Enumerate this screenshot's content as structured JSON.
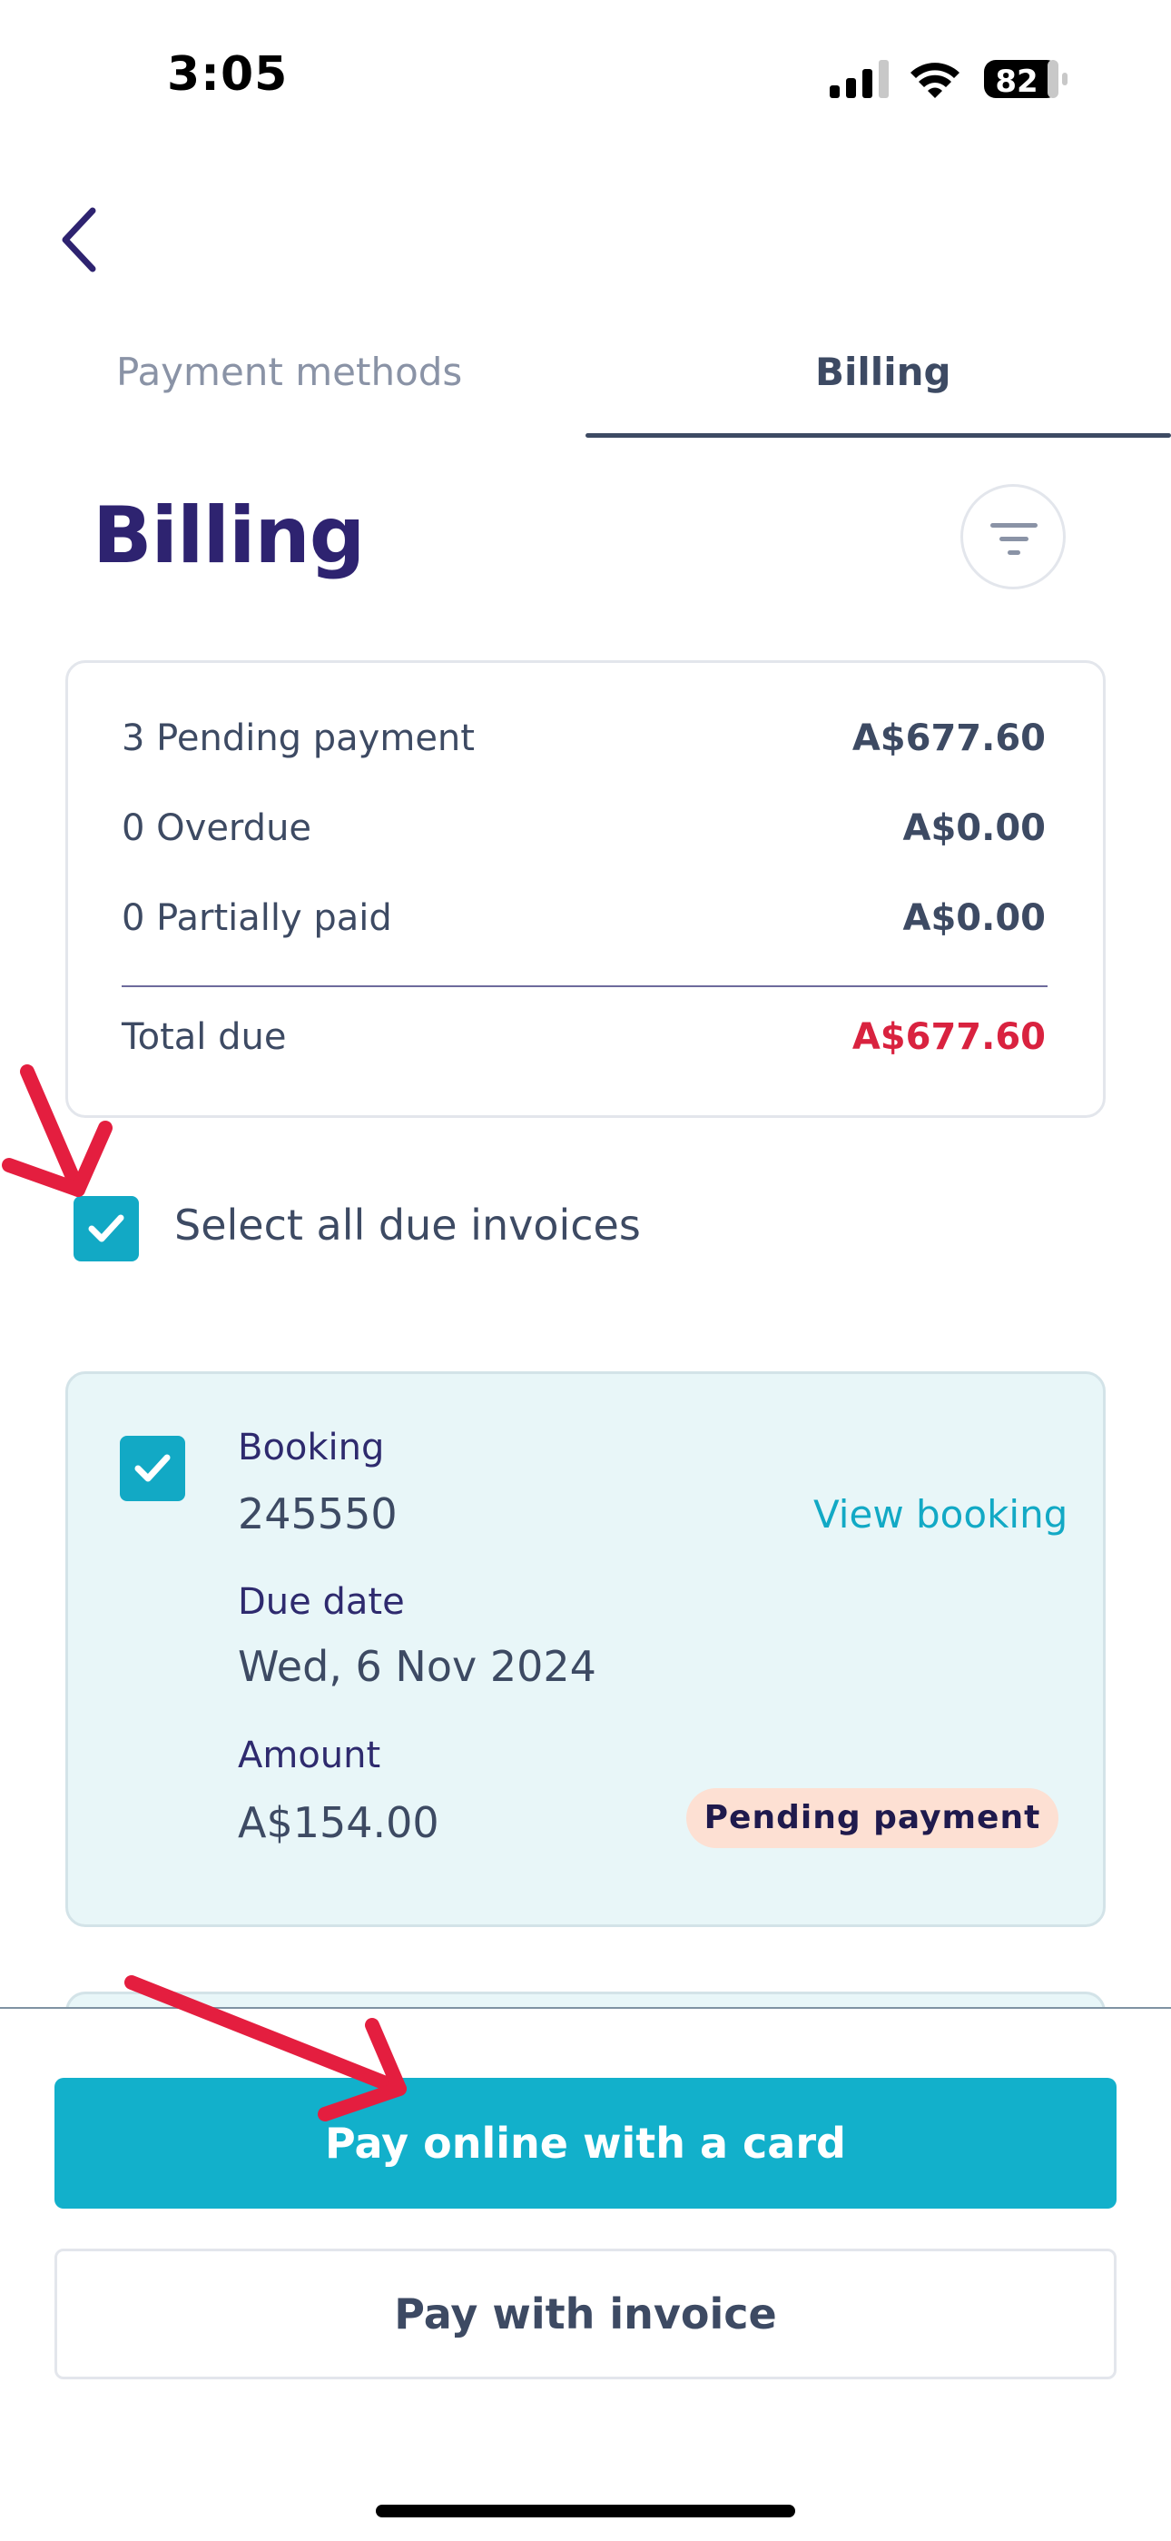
{
  "status_bar": {
    "time": "3:05",
    "battery": "82"
  },
  "tabs": [
    {
      "label": "Payment methods",
      "active": false
    },
    {
      "label": "Billing",
      "active": true
    }
  ],
  "page": {
    "title": "Billing"
  },
  "summary": {
    "rows": [
      {
        "label": "3 Pending payment",
        "value": "A$677.60"
      },
      {
        "label": "0 Overdue",
        "value": "A$0.00"
      },
      {
        "label": "0 Partially paid",
        "value": "A$0.00"
      }
    ],
    "total": {
      "label": "Total due",
      "value": "A$677.60"
    }
  },
  "select_all": {
    "label": "Select all due invoices",
    "checked": true
  },
  "invoice": {
    "checked": true,
    "booking_label": "Booking",
    "booking_number": "245550",
    "view_link": "View booking",
    "due_label": "Due date",
    "due_value": "Wed, 6 Nov 2024",
    "amount_label": "Amount",
    "amount_value": "A$154.00",
    "status": "Pending payment"
  },
  "actions": {
    "pay_card": "Pay online with a card",
    "pay_invoice": "Pay with invoice"
  },
  "colors": {
    "accent": "#12b0cb",
    "title": "#2e2370",
    "alert": "#d9223f",
    "badge_bg": "#fde0d3",
    "card_bg": "#e8f6f8",
    "annotation": "#e41e3f"
  }
}
